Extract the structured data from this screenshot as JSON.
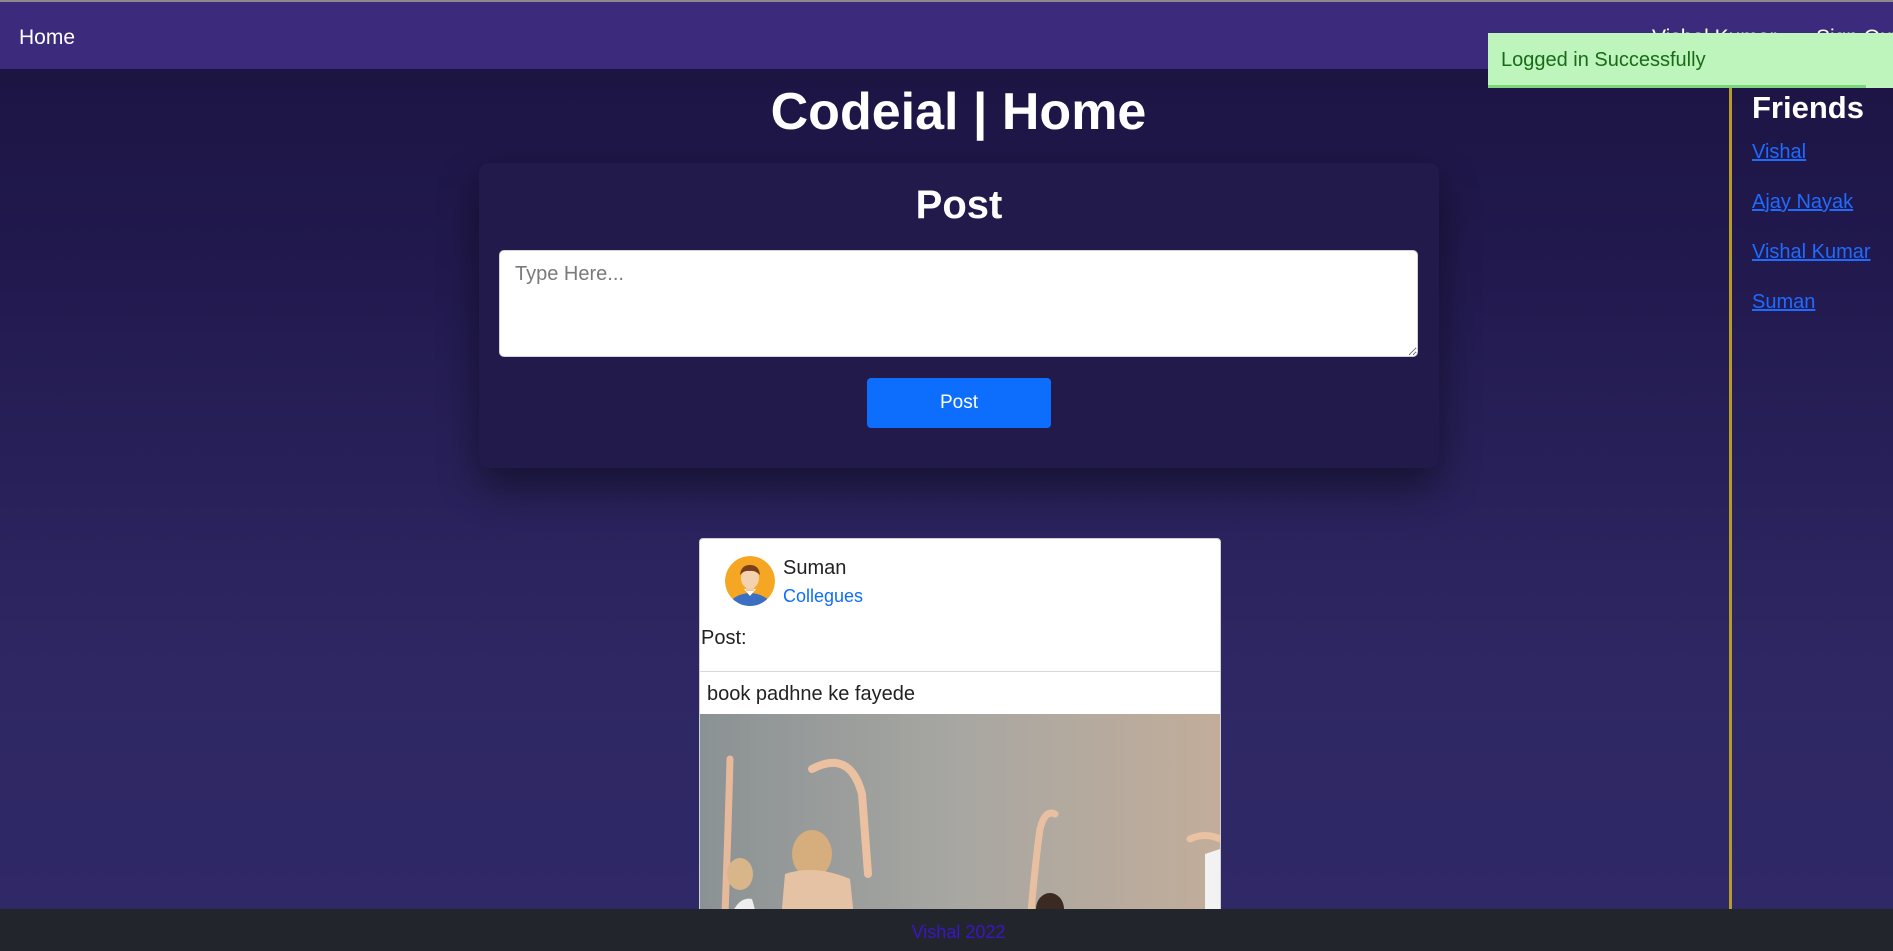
{
  "navbar": {
    "home_label": "Home",
    "user_name": "Vishal Kumar",
    "signout_label": "Sign Out"
  },
  "toast": {
    "message": "Logged in Successfully"
  },
  "page": {
    "title": "Codeial | Home"
  },
  "post_form": {
    "title": "Post",
    "placeholder": "Type Here...",
    "value": "",
    "button_label": "Post"
  },
  "feed": {
    "posts": [
      {
        "author": "Suman",
        "relation": "Collegues",
        "label": "Post:",
        "content": "book padhne ke fayede"
      }
    ]
  },
  "sidebar": {
    "title": "Friends",
    "friends": [
      {
        "name": "Vishal"
      },
      {
        "name": "Ajay Nayak"
      },
      {
        "name": "Vishal Kumar"
      },
      {
        "name": "Suman"
      }
    ]
  },
  "footer": {
    "text": "Vishal 2022"
  },
  "colors": {
    "navbar": "#3c2a7c",
    "accent": "#0d6efd",
    "toast_bg": "#bdf5bd",
    "sidebar_divider": "#b59a2c",
    "footer_text": "#3b16c6"
  }
}
